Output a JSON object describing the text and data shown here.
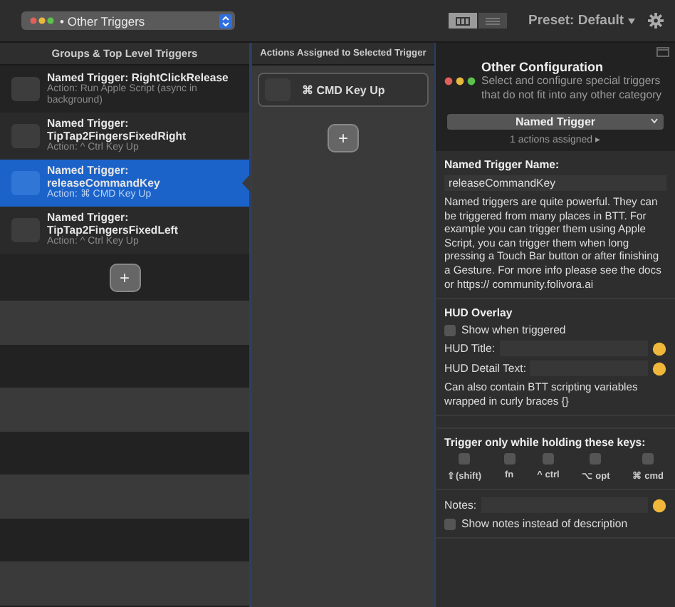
{
  "toolbar": {
    "group_popup": "• Other Triggers",
    "view_modes": [
      {
        "selected": true
      },
      {
        "selected": false
      }
    ],
    "preset": "Preset: Default"
  },
  "columns": {
    "left_header": "Groups & Top Level Triggers",
    "middle_header": "Actions Assigned to Selected Trigger"
  },
  "triggers": [
    {
      "title": "Named Trigger: RightClickRelease",
      "action": "Action: Run Apple Script (async in background)",
      "selected": false
    },
    {
      "title": "Named Trigger: TipTap2FingersFixedRight",
      "action": "Action: ^ Ctrl Key Up",
      "selected": false
    },
    {
      "title": "Named Trigger: releaseCommandKey",
      "action": "Action: ⌘ CMD Key Up",
      "selected": true
    },
    {
      "title": "Named Trigger: TipTap2FingersFixedLeft",
      "action": "Action: ^ Ctrl Key Up",
      "selected": false
    }
  ],
  "add_trigger": "+",
  "actions": [
    {
      "label": "⌘ CMD Key Up"
    }
  ],
  "add_action": "+",
  "config": {
    "title": "Other Configuration",
    "description": "Select and configure special triggers that do not  fit into any other category",
    "type_dropdown": "Named Trigger",
    "assigned": "1 actions assigned ▸",
    "name_label": "Named Trigger Name:",
    "name_value": "releaseCommandKey",
    "help": "Named triggers are quite powerful. They can be triggered from many places in BTT. For example you can trigger them using Apple Script, you can trigger them when long pressing a Touch Bar button or after finishing a Gesture. For more info please see the docs or https:// community.folivora.ai",
    "hud_title": "HUD Overlay",
    "hud_show": {
      "label": "Show when triggered",
      "checked": false
    },
    "hud_fields": [
      {
        "label": "HUD Title:"
      },
      {
        "label": "HUD Detail Text:"
      }
    ],
    "hud_note": "Can also contain BTT scripting variables wrapped in curly braces {}",
    "keys_title": "Trigger only while holding these keys:",
    "keys": [
      {
        "label": "⇧(shift)",
        "checked": false
      },
      {
        "label": "fn",
        "checked": false
      },
      {
        "label": "^ ctrl",
        "checked": false
      },
      {
        "label": "⌥ opt",
        "checked": false
      },
      {
        "label": "⌘ cmd",
        "checked": false
      }
    ],
    "notes_label": "Notes:",
    "notes_show": {
      "label": "Show notes instead of description",
      "checked": false
    }
  }
}
